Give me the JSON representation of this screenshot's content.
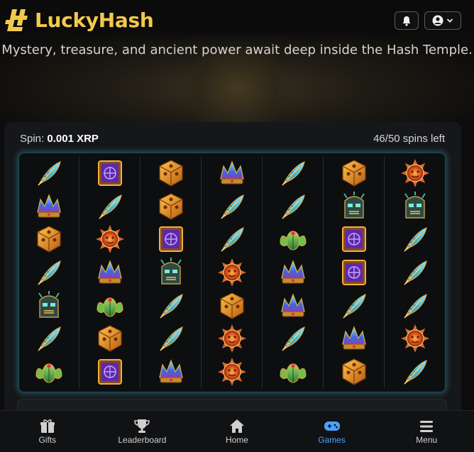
{
  "brand": {
    "name": "LuckyHash",
    "color": "#f2c94c",
    "logo_icon": "hash-logo-icon"
  },
  "header": {
    "notifications_icon": "bell-icon",
    "account_icon": "user-circle-icon",
    "account_chevron": "chevron-down-icon"
  },
  "tagline": "Mystery, treasure, and ancient power await deep inside the Hash Temple.",
  "slot": {
    "spin_label": "Spin:",
    "spin_value": "0.001 XRP",
    "spins_left": "46/50 spins left",
    "reels": [
      [
        "feather",
        "rune-tablet",
        "cube",
        "crystal-crown",
        "feather",
        "cube",
        "sun"
      ],
      [
        "crystal-crown",
        "feather",
        "cube",
        "feather",
        "feather",
        "tiki-mask",
        "tiki-mask"
      ],
      [
        "cube",
        "sun",
        "rune-tablet",
        "feather",
        "scarab",
        "rune-tablet",
        "feather"
      ],
      [
        "feather",
        "crystal-crown",
        "tiki-mask",
        "sun",
        "crystal-crown",
        "rune-tablet",
        "feather"
      ],
      [
        "tiki-mask",
        "scarab",
        "feather",
        "cube",
        "crystal-crown",
        "feather",
        "feather"
      ],
      [
        "feather",
        "cube",
        "feather",
        "sun",
        "feather",
        "crystal-crown",
        "sun"
      ],
      [
        "scarab",
        "rune-tablet",
        "crystal-crown",
        "sun",
        "scarab",
        "cube",
        "feather"
      ]
    ]
  },
  "nav": {
    "items": [
      {
        "label": "Gifts",
        "icon": "gift-icon",
        "active": false
      },
      {
        "label": "Leaderboard",
        "icon": "trophy-icon",
        "active": false
      },
      {
        "label": "Home",
        "icon": "home-icon",
        "active": false
      },
      {
        "label": "Games",
        "icon": "gamepad-icon",
        "active": true
      },
      {
        "label": "Menu",
        "icon": "hamburger-icon",
        "active": false
      }
    ],
    "active_color": "#4aa3ff"
  }
}
